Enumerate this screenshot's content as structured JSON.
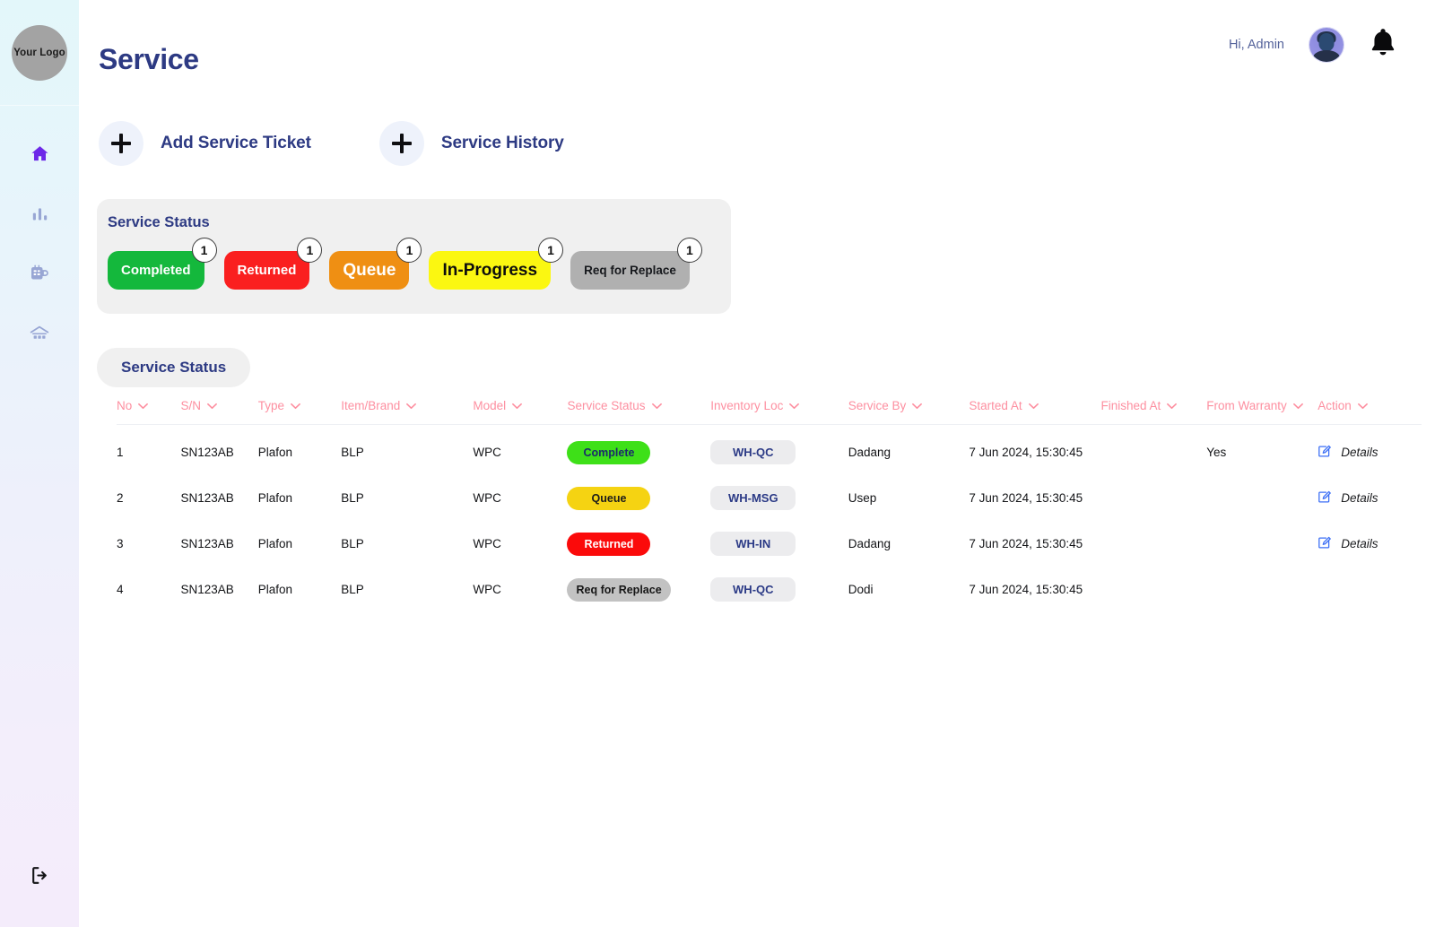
{
  "sidebar": {
    "logo_text": "Your Logo",
    "items": [
      {
        "name": "home",
        "label": "Home",
        "active": true
      },
      {
        "name": "analytics",
        "label": "Analytics",
        "active": false
      },
      {
        "name": "machine",
        "label": "Machine",
        "active": false
      },
      {
        "name": "warehouse",
        "label": "Warehouse",
        "active": false
      }
    ],
    "logout_label": "Logout"
  },
  "header": {
    "title": "Service",
    "greeting": "Hi, Admin",
    "avatar_alt": "Admin avatar",
    "bell_label": "Notifications"
  },
  "actions": [
    {
      "label": "Add Service Ticket",
      "icon": "plus-icon"
    },
    {
      "label": "Service History",
      "icon": "plus-icon"
    }
  ],
  "status_card": {
    "title": "Service Status",
    "chips": [
      {
        "label": "Completed",
        "count": "1",
        "color": "#14b83c"
      },
      {
        "label": "Returned",
        "count": "1",
        "color": "#fa1f1f"
      },
      {
        "label": "Queue",
        "count": "1",
        "color": "#ef8f13"
      },
      {
        "label": "In-Progress",
        "count": "1",
        "color": "#fbf711"
      },
      {
        "label": "Req for Replace",
        "count": "1",
        "color": "#b0b0b0"
      }
    ]
  },
  "tab": {
    "label": "Service Status"
  },
  "table": {
    "columns": [
      {
        "label": "No",
        "sortable": true
      },
      {
        "label": "S/N",
        "sortable": true
      },
      {
        "label": "Type",
        "sortable": true
      },
      {
        "label": "Item/Brand",
        "sortable": true
      },
      {
        "label": "Model",
        "sortable": true
      },
      {
        "label": "Service Status",
        "sortable": true
      },
      {
        "label": "Inventory Loc",
        "sortable": true
      },
      {
        "label": "Service By",
        "sortable": true
      },
      {
        "label": "Started At",
        "sortable": true
      },
      {
        "label": "Finished At",
        "sortable": true
      },
      {
        "label": "From Warranty",
        "sortable": true
      },
      {
        "label": "Action",
        "sortable": true
      }
    ],
    "rows": [
      {
        "no": "1",
        "sn": "SN123AB",
        "type": "Plafon",
        "item": "BLP",
        "model": "WPC",
        "status": "Complete",
        "status_class": "complete",
        "loc": "WH-QC",
        "by": "Dadang",
        "started": "7 Jun 2024, 15:30:45",
        "finished": "",
        "warranty": "Yes",
        "action": "Details",
        "has_action": true
      },
      {
        "no": "2",
        "sn": "SN123AB",
        "type": "Plafon",
        "item": "BLP",
        "model": "WPC",
        "status": "Queue",
        "status_class": "queue",
        "loc": "WH-MSG",
        "by": "Usep",
        "started": "7 Jun 2024, 15:30:45",
        "finished": "",
        "warranty": "",
        "action": "Details",
        "has_action": true
      },
      {
        "no": "3",
        "sn": "SN123AB",
        "type": "Plafon",
        "item": "BLP",
        "model": "WPC",
        "status": "Returned",
        "status_class": "returned",
        "loc": "WH-IN",
        "by": "Dadang",
        "started": "7 Jun 2024, 15:30:45",
        "finished": "",
        "warranty": "",
        "action": "Details",
        "has_action": true
      },
      {
        "no": "4",
        "sn": "SN123AB",
        "type": "Plafon",
        "item": "BLP",
        "model": "WPC",
        "status": "Req for Replace",
        "status_class": "reqreplace",
        "loc": "WH-QC",
        "by": "Dodi",
        "started": "7 Jun 2024, 15:30:45",
        "finished": "",
        "warranty": "",
        "action": "",
        "has_action": false
      }
    ]
  },
  "colors": {
    "brand_navy": "#2d3a83",
    "header_pink": "#fd8fa0",
    "accent_purple": "#6d28e8",
    "link_blue": "#3b6ef5"
  }
}
